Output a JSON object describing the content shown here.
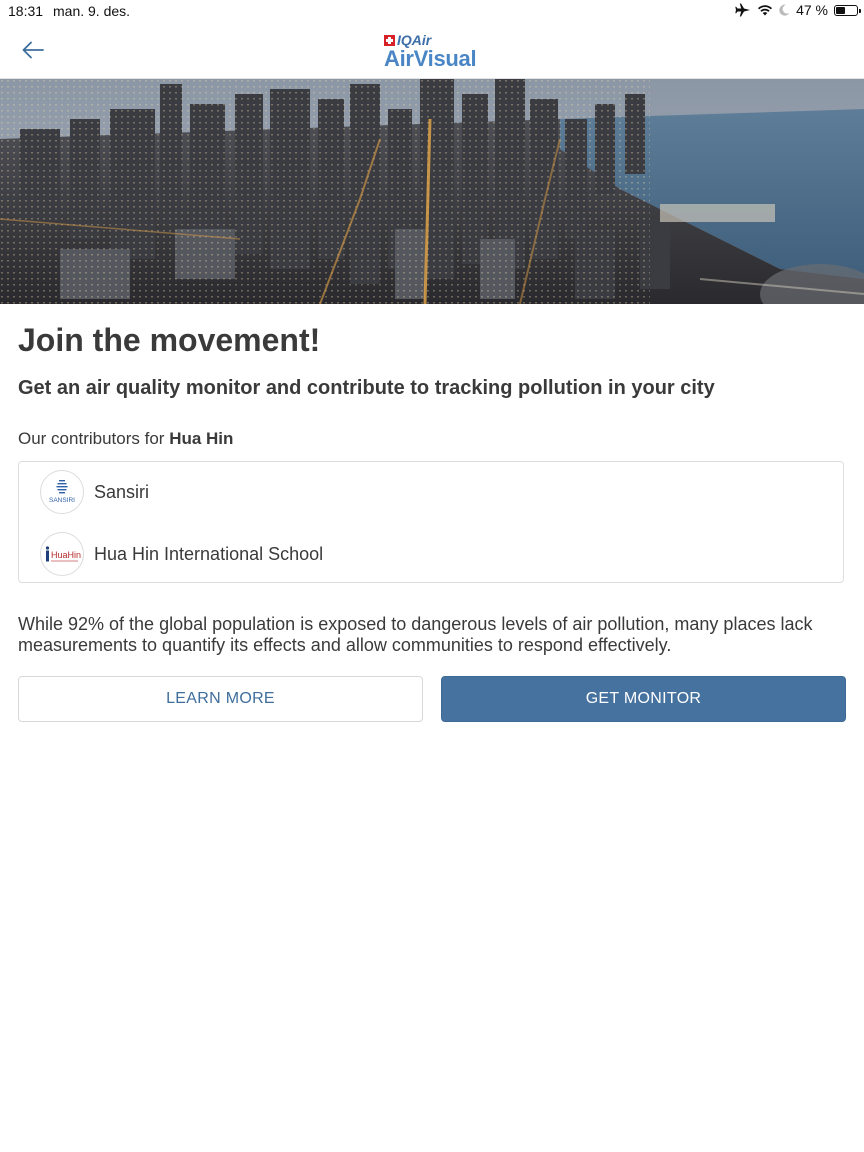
{
  "status_bar": {
    "time": "18:31",
    "date": "man. 9. des.",
    "battery": "47 %",
    "battery_level": 0.47,
    "icons": [
      "airplane-icon",
      "wifi-icon",
      "moon-icon",
      "battery-icon"
    ]
  },
  "header": {
    "back_icon": "arrow-left-icon",
    "logo_brand": "IQAir",
    "logo_product": "AirVisual"
  },
  "hero": {
    "image": "city-skyline-dusk"
  },
  "main": {
    "title": "Join the movement!",
    "subtitle": "Get an air quality monitor and contribute to tracking pollution in your city",
    "contributors_prefix": "Our contributors for",
    "city": "Hua Hin",
    "contributors": [
      {
        "name": "Sansiri",
        "logo_text": "SANSIRI"
      },
      {
        "name": "Hua Hin International School",
        "logo_text": "HuaHin"
      }
    ],
    "blurb": "While 92% of the global population is exposed to dangerous levels of air pollution, many places lack measurements to quantify its effects and allow communities to respond effectively.",
    "learn_more": "LEARN MORE",
    "get_monitor": "GET MONITOR"
  },
  "colors": {
    "primary_button": "#46729f",
    "link_text": "#3f6e9c",
    "logo_blue": "#4a86c5",
    "swiss_red": "#d72027"
  }
}
